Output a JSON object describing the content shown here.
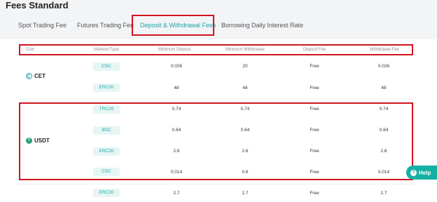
{
  "page_title": "Fees Standard",
  "tabs": [
    {
      "label": "Spot Trading Fee"
    },
    {
      "label": "Futures Trading Fee"
    },
    {
      "label": "Deposit & Withdrawal Fees"
    },
    {
      "label": "Borrowing Daily Interest Rate"
    }
  ],
  "table": {
    "headers": [
      "Coin",
      "Mainnet Type",
      "Minimum Deposit",
      "Minimum Withdrawal",
      "Deposit Fee",
      "Withdrawal Fee"
    ],
    "groups": [
      {
        "coin": "CET",
        "icon": "cet-coin-icon",
        "rows": [
          {
            "mainnet": "CSC",
            "min_deposit": "0.026",
            "min_withdrawal": "20",
            "deposit_fee": "Free",
            "withdrawal_fee": "0.026"
          },
          {
            "mainnet": "ERC20",
            "min_deposit": "48",
            "min_withdrawal": "48",
            "deposit_fee": "Free",
            "withdrawal_fee": "48"
          }
        ]
      },
      {
        "coin": "USDT",
        "icon": "usdt-coin-icon",
        "rows": [
          {
            "mainnet": "TRC20",
            "min_deposit": "0.74",
            "min_withdrawal": "0.74",
            "deposit_fee": "Free",
            "withdrawal_fee": "0.74"
          },
          {
            "mainnet": "BSC",
            "min_deposit": "0.64",
            "min_withdrawal": "0.64",
            "deposit_fee": "Free",
            "withdrawal_fee": "0.64"
          },
          {
            "mainnet": "ERC20",
            "min_deposit": "2.6",
            "min_withdrawal": "2.6",
            "deposit_fee": "Free",
            "withdrawal_fee": "2.6"
          },
          {
            "mainnet": "CSC",
            "min_deposit": "0.014",
            "min_withdrawal": "0.6",
            "deposit_fee": "Free",
            "withdrawal_fee": "0.014"
          }
        ]
      },
      {
        "coin": "",
        "rows": [
          {
            "mainnet": "ERC20",
            "min_deposit": "2.7",
            "min_withdrawal": "2.7",
            "deposit_fee": "Free",
            "withdrawal_fee": "2.7"
          }
        ]
      }
    ]
  },
  "help": {
    "label": "Help",
    "icon_glyph": "?"
  },
  "colors": {
    "accent": "#20a3a8",
    "highlight_border": "#d0141f",
    "help_bg": "#15b0a4",
    "usdt": "#26a17b"
  }
}
